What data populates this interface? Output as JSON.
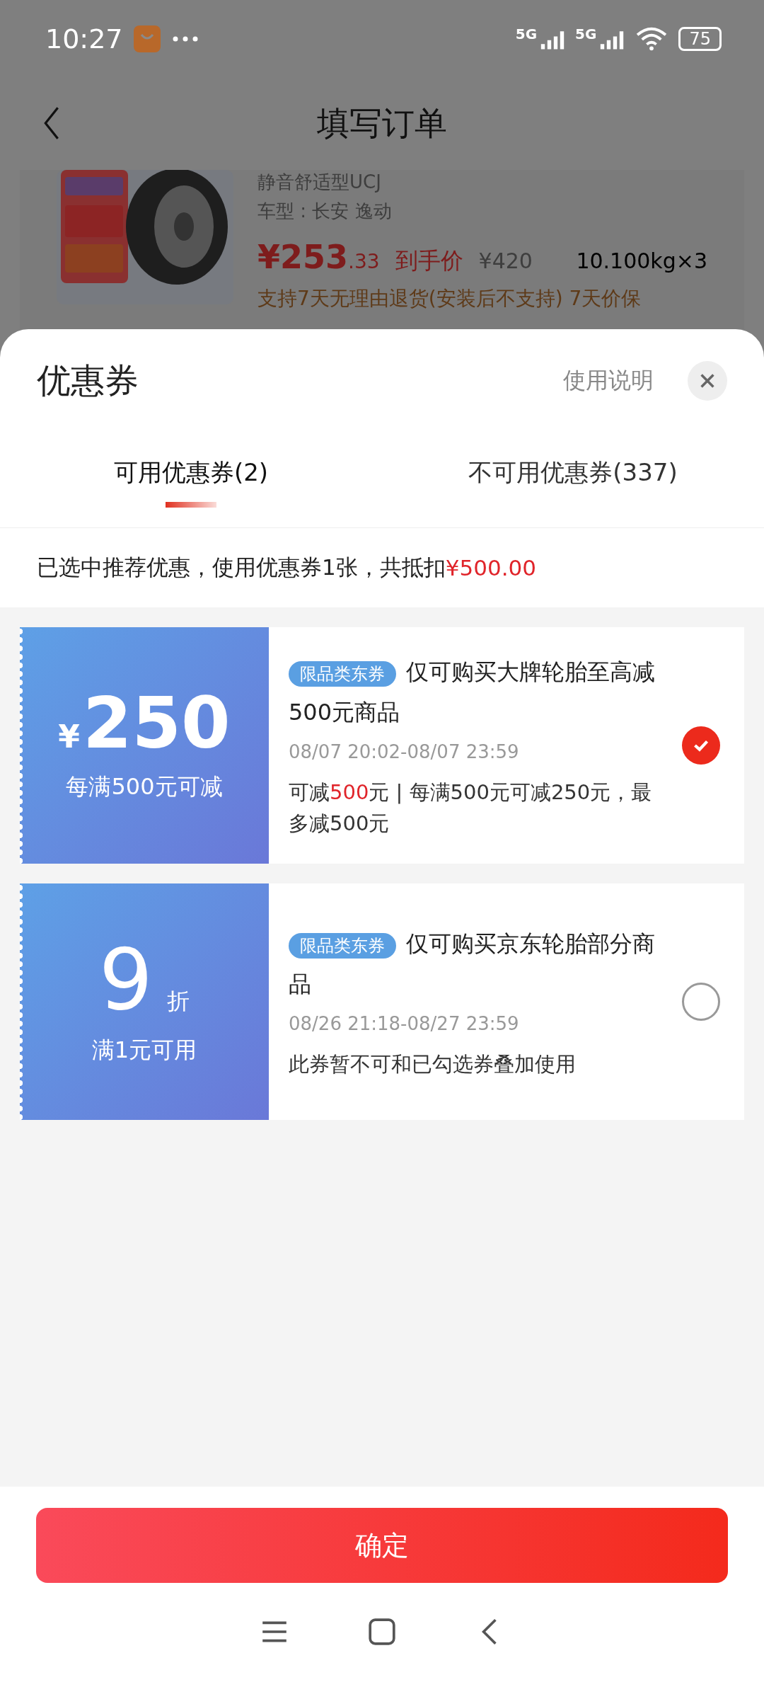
{
  "status_bar": {
    "time": "10:27",
    "battery": "75",
    "networks": [
      "5G",
      "5G"
    ]
  },
  "header": {
    "title": "填写订单"
  },
  "product": {
    "spec": "静音舒适型UCJ",
    "car": "车型 : 长安 逸动",
    "price_int": "¥253",
    "price_dec": ".33",
    "price_label": "到手价",
    "original_price": "¥420",
    "weight": "10.100kg×3",
    "service": "支持7天无理由退货(安装后不支持) 7天价保"
  },
  "sheet": {
    "title": "优惠券",
    "help": "使用说明",
    "tabs": [
      {
        "label": "可用优惠券(2)",
        "selected": true
      },
      {
        "label": "不可用优惠券(337)",
        "selected": false
      }
    ],
    "summary": {
      "text": "已选中推荐优惠，使用优惠券1张，共抵扣",
      "amount": "¥500.00"
    },
    "coupons": [
      {
        "kind": "amount",
        "symbol": "¥",
        "value": "250",
        "condition": "每满500元可减",
        "tag": "限品类东券",
        "title": "仅可购买大牌轮胎至高减500元商品",
        "period": "08/07 20:02-08/07 23:59",
        "note": [
          {
            "text": "可减",
            "highlight": false
          },
          {
            "text": "500",
            "highlight": true
          },
          {
            "text": "元 | 每满500元可减250元，最多减500元",
            "highlight": false
          }
        ],
        "selected": true
      },
      {
        "kind": "discount",
        "value": "9",
        "unit": "折",
        "condition": "满1元可用",
        "tag": "限品类东券",
        "title": "仅可购买京东轮胎部分商品",
        "period": "08/26 21:18-08/27 23:59",
        "note": [
          {
            "text": "此券暂不可和已勾选券叠加使用",
            "highlight": false
          }
        ],
        "selected": false
      }
    ]
  },
  "confirm_button": "确定"
}
